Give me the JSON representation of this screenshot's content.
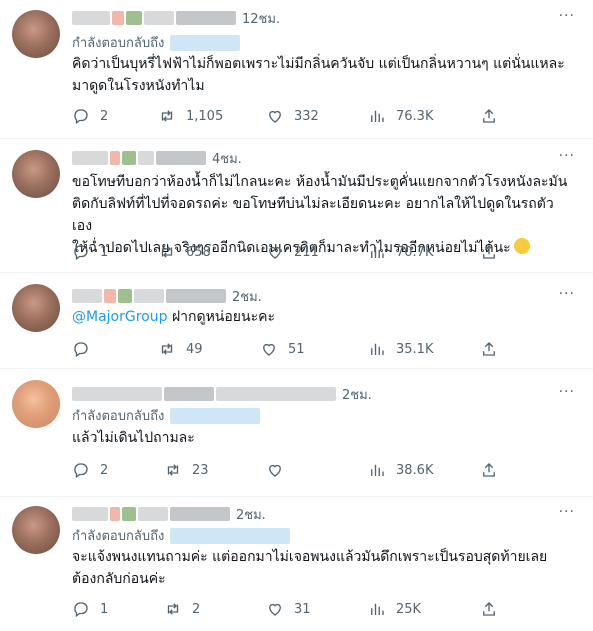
{
  "tweets": [
    {
      "time": "12ชม.",
      "more": "···",
      "reply_prefix": "กำลังตอบกลับถึง",
      "lines": [
        "คิดว่าเป็นบุหรี่ไฟฟ้าไม่ก็พอตเพราะไม่มีกลิ่นควันจับ แต่เป็นกลิ่นหวานๆ แต่นั่นแหละ",
        "มาดูดในโรงหนังทำไม"
      ],
      "stats": {
        "reply": "2",
        "retweet": "1,105",
        "like": "332",
        "views": "76.3K"
      }
    },
    {
      "time": "4ชม.",
      "more": "···",
      "lines": [
        "ขอโทษทีบอกว่าห้องน้ำก็ไม่ไกลนะคะ ห้องน้ำมันมีประตูคั่นแยกจากตัวโรงหนังละมัน",
        "ติดกับลิฟท์ที่ไปที่จอดรถค่ะ ขอโทษทีบ่นไม่ละเอียดนะคะ อยากไลให้ไปดูดในรถตัวเอง",
        "ให้ฉ่ำปอดไปเลย จริงๆรออีกนิดเอนเครดิตก็มาละทำไมรออีกหน่อยไม่ได้นะ"
      ],
      "stats": {
        "reply": "1",
        "retweet": "658",
        "like": "211",
        "views": "70.7K"
      }
    },
    {
      "time": "2ชม.",
      "more": "···",
      "mention": "@MajorGroup",
      "text": " ฝากดูหน่อยนะคะ",
      "stats": {
        "reply": "",
        "retweet": "49",
        "like": "51",
        "views": "35.1K"
      }
    },
    {
      "time": "2ชม.",
      "more": "···",
      "reply_prefix": "กำลังตอบกลับถึง",
      "lines": [
        "แล้วไม่เดินไปถามละ"
      ],
      "stats": {
        "reply": "2",
        "retweet": "23",
        "like": "",
        "views": "38.6K"
      }
    },
    {
      "time": "2ชม.",
      "more": "···",
      "reply_prefix": "กำลังตอบกลับถึง",
      "lines": [
        "จะแจ้งพนงแทนถามค่ะ แต่ออกมาไม่เจอพนงแล้วมันดึกเพราะเป็นรอบสุดท้ายเลย",
        "ต้องกลับก่อนค่ะ"
      ],
      "stats": {
        "reply": "1",
        "retweet": "2",
        "like": "31",
        "views": "25K"
      }
    }
  ]
}
